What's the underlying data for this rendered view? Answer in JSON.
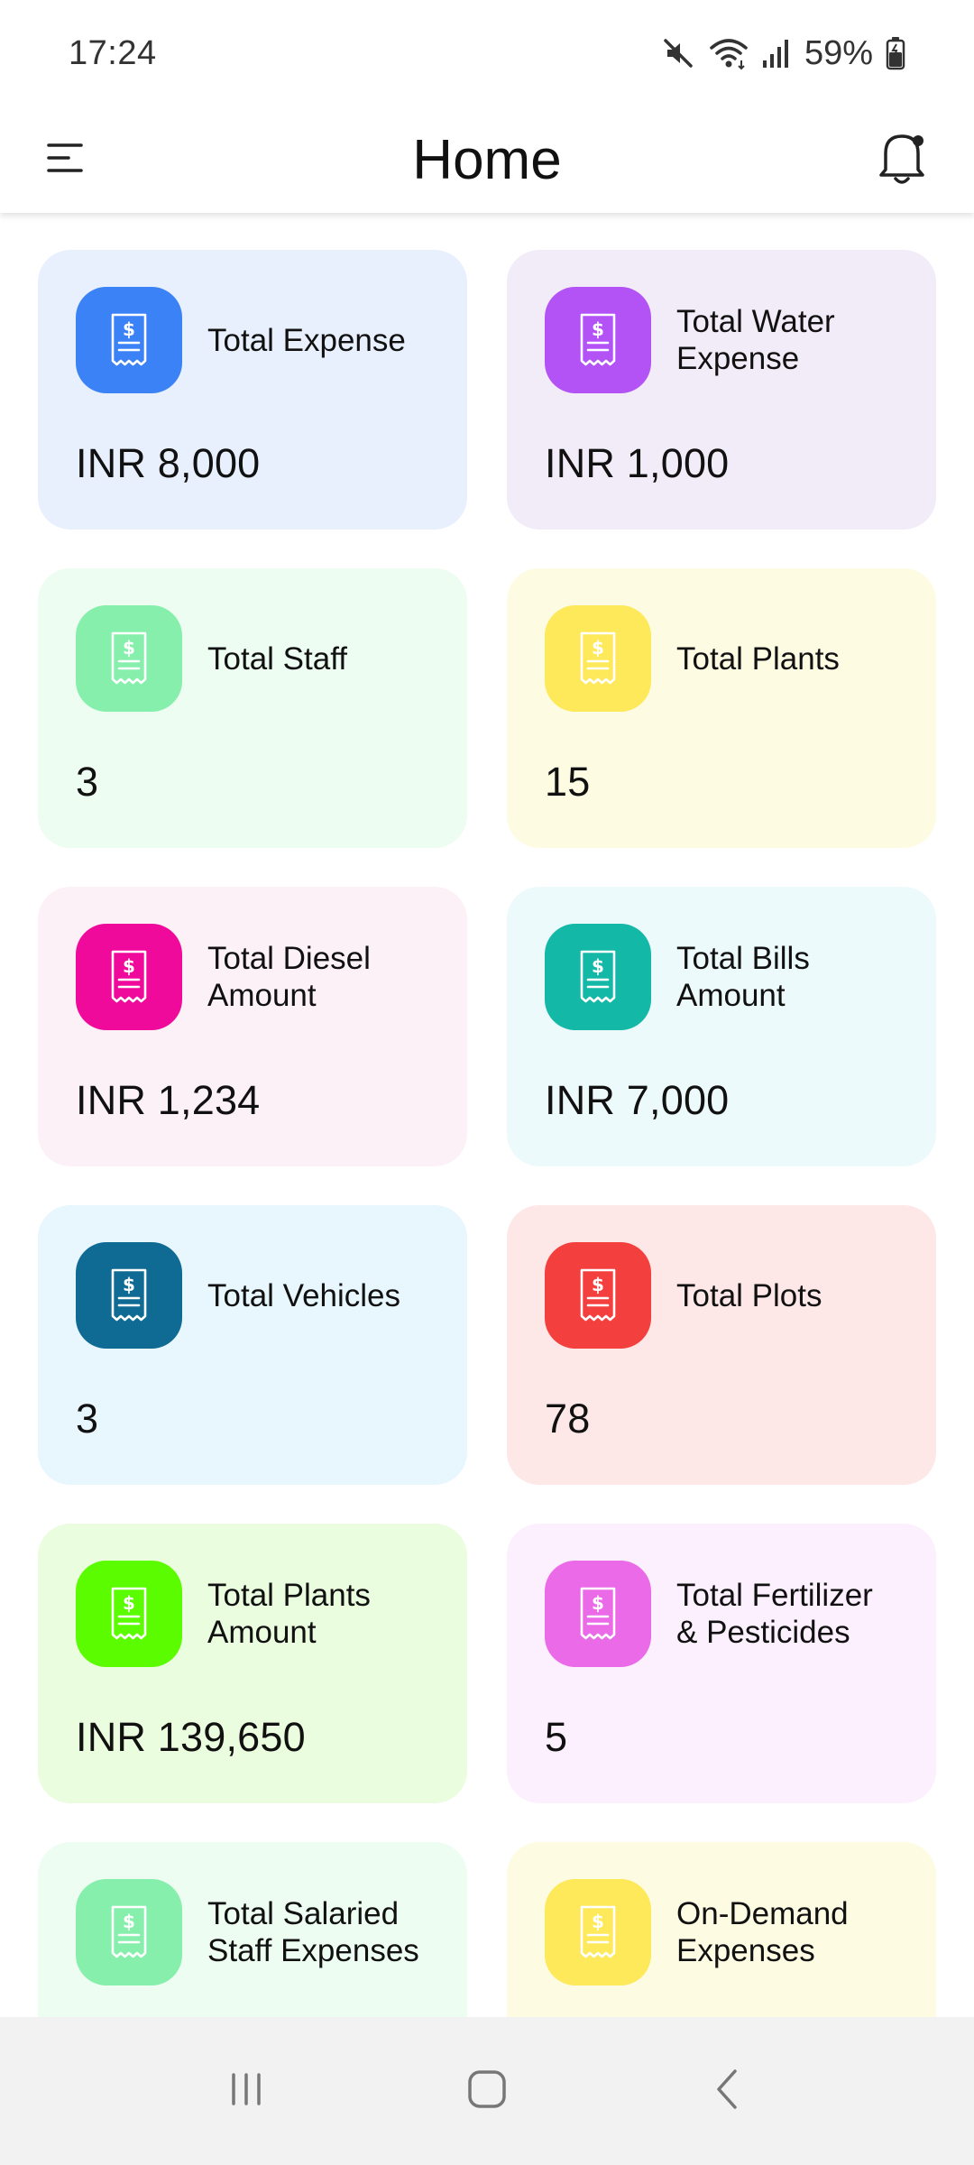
{
  "status_bar": {
    "time": "17:24",
    "battery": "59%",
    "icons": [
      "mute-icon",
      "wifi-icon",
      "signal-icon",
      "battery-icon"
    ]
  },
  "app_bar": {
    "title": "Home",
    "icons": [
      "menu-icon",
      "bell-icon"
    ]
  },
  "cards": [
    {
      "label": "Total Expense",
      "value": "INR 8,000",
      "bg": "#e8f0fe",
      "icon_bg": "#3b82f6",
      "icon": "receipt-icon"
    },
    {
      "label": "Total Water\nExpense",
      "value": "INR 1,000",
      "bg": "#f2ecf9",
      "icon_bg": "#b352f5",
      "icon": "receipt-icon"
    },
    {
      "label": "Total Staff",
      "value": "3",
      "bg": "#edfdf2",
      "icon_bg": "#86efac",
      "icon": "receipt-icon"
    },
    {
      "label": "Total Plants",
      "value": "15",
      "bg": "#fefbe3",
      "icon_bg": "#fde95a",
      "icon": "receipt-icon"
    },
    {
      "label": "Total Diesel\nAmount",
      "value": "INR 1,234",
      "bg": "#fdf1f8",
      "icon_bg": "#ef0a9c",
      "icon": "receipt-icon"
    },
    {
      "label": "Total Bills\nAmount",
      "value": "INR 7,000",
      "bg": "#edfafb",
      "icon_bg": "#14b8a6",
      "icon": "receipt-icon"
    },
    {
      "label": "Total Vehicles",
      "value": "3",
      "bg": "#e8f6fe",
      "icon_bg": "#0f6b93",
      "icon": "receipt-icon"
    },
    {
      "label": "Total Plots",
      "value": "78",
      "bg": "#fde7e7",
      "icon_bg": "#f43f3f",
      "icon": "receipt-icon"
    },
    {
      "label": "Total Plants\nAmount",
      "value": "INR 139,650",
      "bg": "#eafdde",
      "icon_bg": "#5cfc00",
      "icon": "receipt-icon"
    },
    {
      "label": "Total Fertilizer\n& Pesticides",
      "value": "5",
      "bg": "#fcf0fe",
      "icon_bg": "#ea6ae8",
      "icon": "receipt-icon"
    },
    {
      "label": "Total Salaried\nStaff Expenses",
      "value": "",
      "bg": "#edfdf2",
      "icon_bg": "#86efac",
      "icon": "receipt-icon"
    },
    {
      "label": "On-Demand\nExpenses",
      "value": "",
      "bg": "#fefbe3",
      "icon_bg": "#fde95a",
      "icon": "receipt-icon"
    }
  ],
  "nav_bar": {
    "icons": [
      "recent-apps-icon",
      "home-icon",
      "back-icon"
    ]
  }
}
